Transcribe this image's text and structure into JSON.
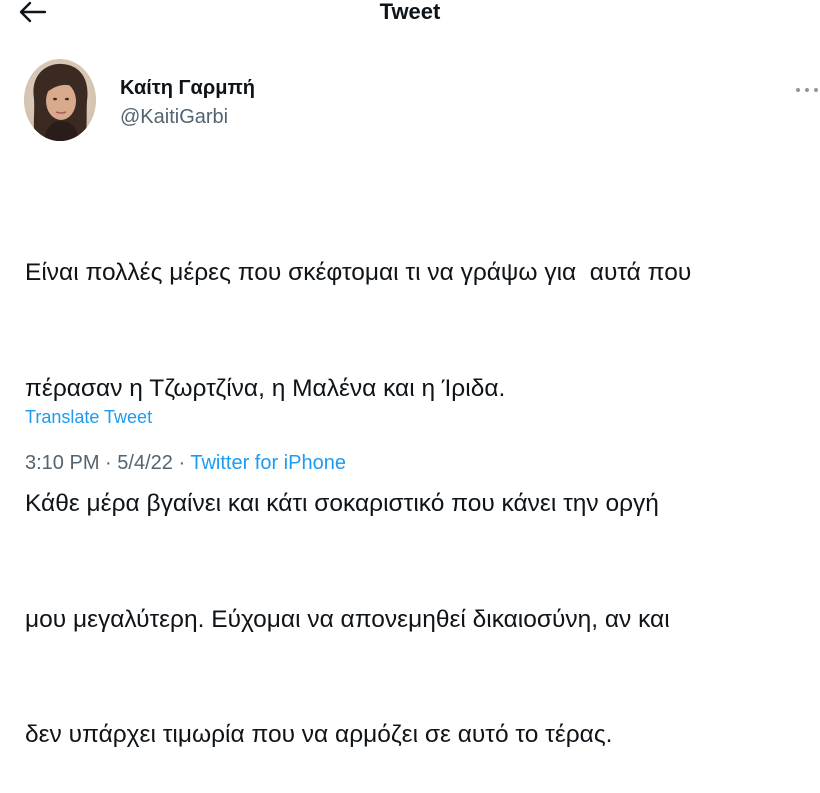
{
  "header": {
    "title": "Tweet",
    "back_icon": "arrow-left-icon"
  },
  "author": {
    "name": "Καίτη Γαρμπή",
    "handle": "@KaitiGarbi"
  },
  "more_icon": "more-horizontal-icon",
  "tweet": {
    "lines": [
      "Είναι πολλές μέρες που σκέφτομαι τι να γράψω για  αυτά που",
      "πέρασαν η Τζωρτζίνα, η Μαλένα και η Ίριδα.",
      "Κάθε μέρα βγαίνει και κάτι σοκαριστικό που κάνει την οργή",
      "μου μεγαλύτερη. Εύχομαι να απονεμηθεί δικαιοσύνη, αν και",
      "δεν υπάρχει τιμωρία που να αρμόζει σε αυτό το τέρας."
    ],
    "translate_label": "Translate Tweet"
  },
  "meta": {
    "time": "3:10 PM",
    "separator": "·",
    "date": "5/4/22",
    "source": "Twitter for iPhone"
  },
  "colors": {
    "text": "#0f1419",
    "secondary": "#536471",
    "accent": "#1d9bf0"
  }
}
